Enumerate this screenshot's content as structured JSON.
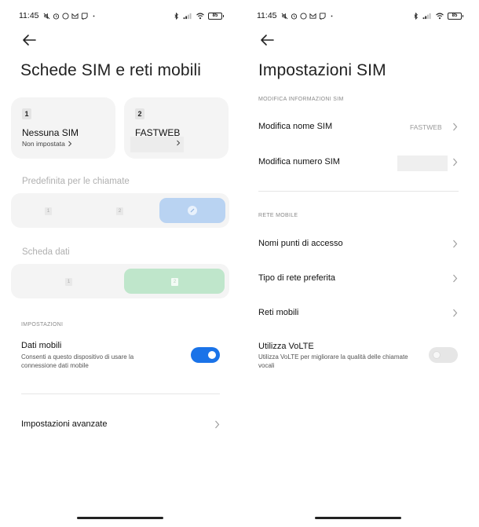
{
  "status_bar": {
    "time": "11:45",
    "battery": "85"
  },
  "left_screen": {
    "title": "Schede SIM e reti mobili",
    "sim1": {
      "number": "1",
      "name": "Nessuna SIM",
      "status": "Non impostata"
    },
    "sim2": {
      "number": "2",
      "name": "FASTWEB"
    },
    "calls_section": "Predefinita per le chiamate",
    "calls_options": [
      "1",
      "2"
    ],
    "data_section": "Scheda dati",
    "data_options": [
      "1",
      "2"
    ],
    "settings_header": "IMPOSTAZIONI",
    "mobile_data": {
      "title": "Dati mobili",
      "description": "Consenti a questo dispositivo di usare la connessione dati mobile",
      "enabled": true
    },
    "advanced": "Impostazioni avanzate"
  },
  "right_screen": {
    "title": "Impostazioni SIM",
    "edit_header": "MODIFICA INFORMAZIONI SIM",
    "edit_name": {
      "title": "Modifica nome SIM",
      "value": "FASTWEB"
    },
    "edit_number": {
      "title": "Modifica numero SIM"
    },
    "network_header": "RETE MOBILE",
    "apn": "Nomi punti di accesso",
    "preferred_network": "Tipo di rete preferita",
    "mobile_networks": "Reti mobili",
    "volte": {
      "title": "Utilizza VoLTE",
      "description": "Utilizza VoLTE per migliorare la qualità delle chiamate vocali",
      "enabled": false
    }
  },
  "colors": {
    "toggle_on": "#1a73e8",
    "toggle_off": "#e6e6e6",
    "calls_selected": "#b9d3f2",
    "data_selected": "#bfe6cb"
  }
}
